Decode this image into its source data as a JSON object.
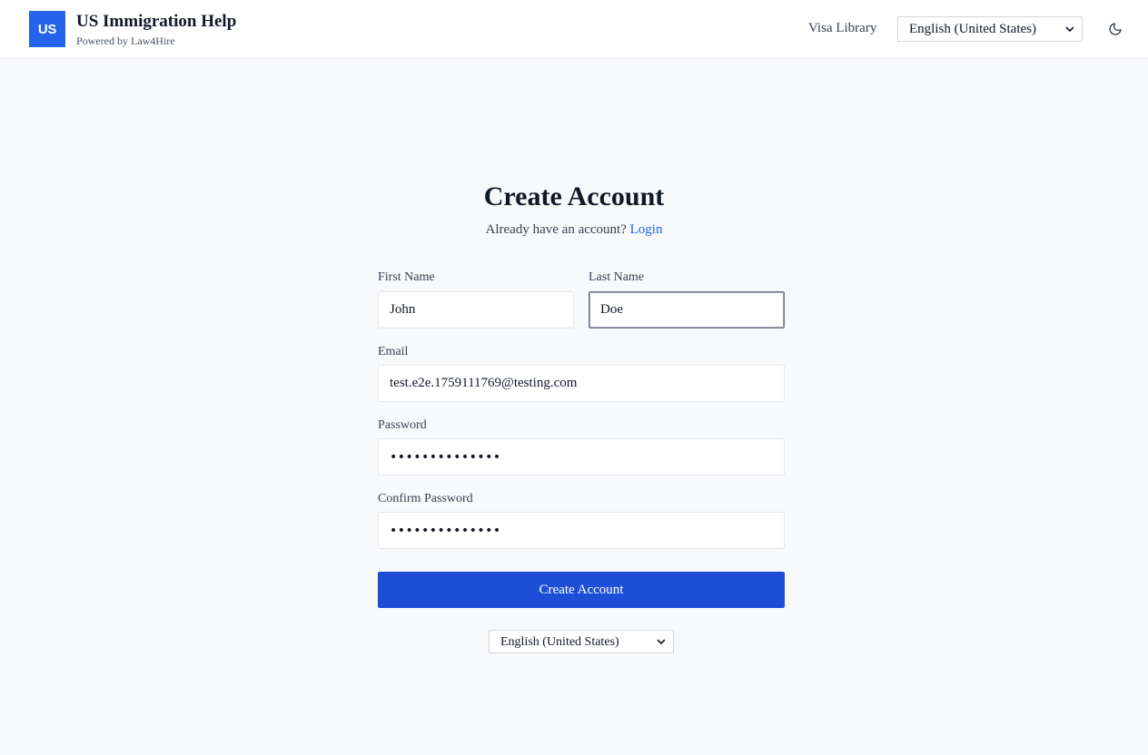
{
  "header": {
    "logo_text": "US",
    "title": "US Immigration Help",
    "subtitle": "Powered by Law4Hire",
    "nav_link": "Visa Library",
    "language_selected": "English (United States)",
    "theme_icon": "moon-icon"
  },
  "form": {
    "title": "Create Account",
    "subtitle_prefix": "Already have an account?",
    "login_link": "Login",
    "first_name": {
      "label": "First Name",
      "value": "John"
    },
    "last_name": {
      "label": "Last Name",
      "value": "Doe"
    },
    "email": {
      "label": "Email",
      "value": "test.e2e.1759111769@testing.com"
    },
    "password": {
      "label": "Password",
      "value": "••••••••••••••"
    },
    "confirm_password": {
      "label": "Confirm Password",
      "value": "••••••••••••••"
    },
    "submit_label": "Create Account"
  },
  "footer": {
    "language_selected": "English (United States)"
  },
  "colors": {
    "brand": "#2563eb",
    "button": "#1d4ed8",
    "background": "#f8f9fb"
  }
}
